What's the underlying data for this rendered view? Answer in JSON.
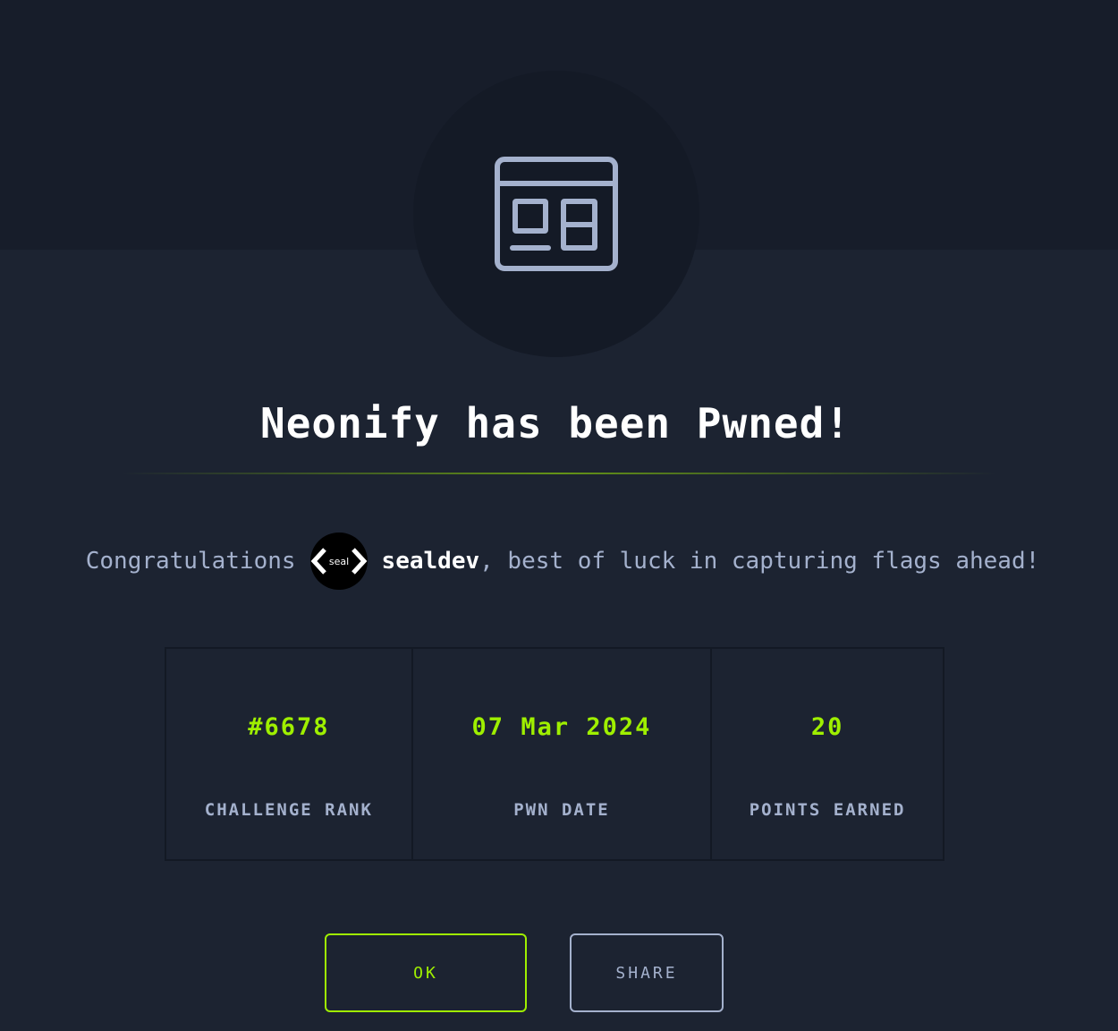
{
  "modal": {
    "icon": "web-app-window-icon",
    "title": "Neonify has been Pwned!",
    "congrats": {
      "prefix": "Congratulations",
      "avatar_text": "seal",
      "username": "sealdev",
      "suffix": ", best of luck in capturing flags ahead!"
    },
    "stats": [
      {
        "value": "#6678",
        "label": "CHALLENGE RANK"
      },
      {
        "value": "07 Mar 2024",
        "label": "PWN DATE"
      },
      {
        "value": "20",
        "label": "POINTS EARNED"
      }
    ],
    "buttons": {
      "ok_label": "OK",
      "share_label": "SHARE"
    }
  },
  "colors": {
    "background": "#1c2331",
    "top_band": "#171d2a",
    "accent_green": "#9fef00",
    "muted_text": "#a4b1cd",
    "title_text": "#ffffff"
  }
}
